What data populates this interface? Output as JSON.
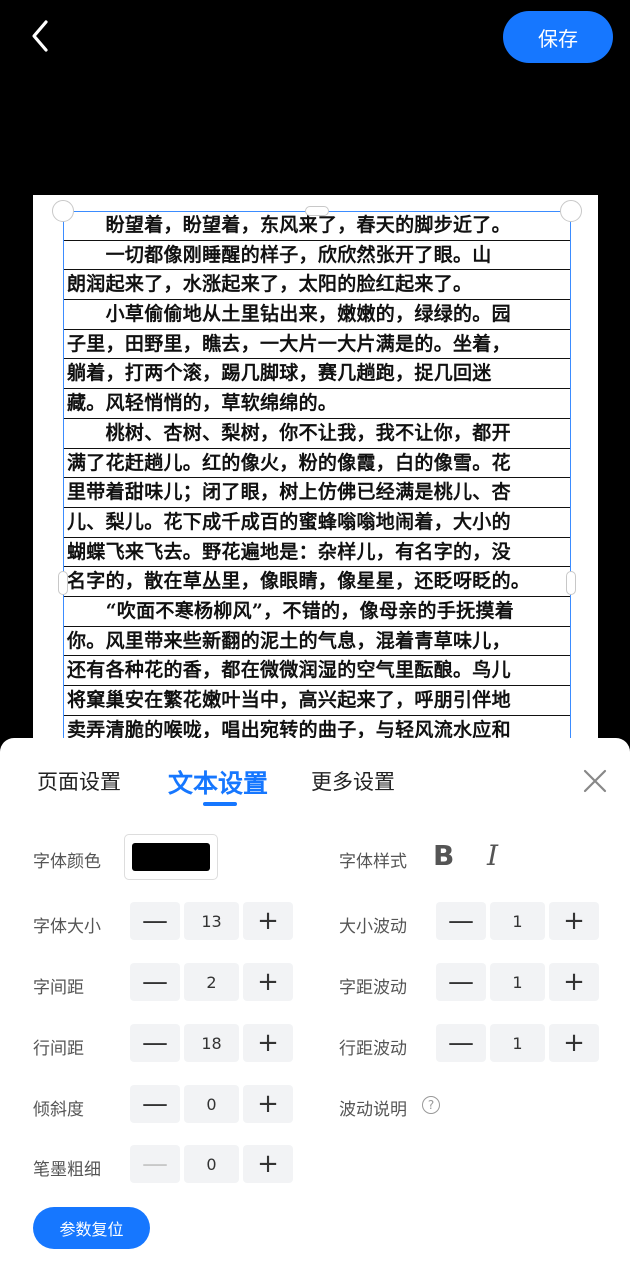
{
  "header": {
    "save_label": "保存",
    "back_icon": "chevron-left-icon"
  },
  "paper": {
    "lines": [
      "　　盼望着，盼望着，东风来了，春天的脚步近了。",
      "　　一切都像刚睡醒的样子，欣欣然张开了眼。山",
      "朗润起来了，水涨起来了，太阳的脸红起来了。",
      "　　小草偷偷地从土里钻出来，嫩嫩的，绿绿的。园",
      "子里，田野里，瞧去，一大片一大片满是的。坐着，",
      "躺着，打两个滚，踢几脚球，赛几趟跑，捉几回迷",
      "藏。风轻悄悄的，草软绵绵的。",
      "　　桃树、杏树、梨树，你不让我，我不让你，都开",
      "满了花赶趟儿。红的像火，粉的像霞，白的像雪。花",
      "里带着甜味儿；闭了眼，树上仿佛已经满是桃儿、杏",
      "儿、梨儿。花下成千成百的蜜蜂嗡嗡地闹着，大小的",
      "蝴蝶飞来飞去。野花遍地是：杂样儿，有名字的，没",
      "名字的，散在草丛里，像眼睛，像星星，还眨呀眨的。",
      "　　“吹面不寒杨柳风”，不错的，像母亲的手抚摸着",
      "你。风里带来些新翻的泥土的气息，混着青草味儿，",
      "还有各种花的香，都在微微润湿的空气里酝酿。鸟儿",
      "将窠巢安在繁花嫩叶当中，高兴起来了，呼朋引伴地",
      "卖弄清脆的喉咙，唱出宛转的曲子，与轻风流水应和"
    ]
  },
  "tabs": [
    {
      "label": "页面设置"
    },
    {
      "label": "文本设置"
    },
    {
      "label": "更多设置"
    }
  ],
  "settings": {
    "font_color_label": "字体颜色",
    "font_color": "#000000",
    "font_style_label": "字体样式",
    "bold_glyph": "B",
    "italic_glyph": "I",
    "font_size": {
      "label": "字体大小",
      "value": "13"
    },
    "size_wave": {
      "label": "大小波动",
      "value": "1"
    },
    "char_spacing": {
      "label": "字间距",
      "value": "2"
    },
    "spacing_wave": {
      "label": "字距波动",
      "value": "1"
    },
    "line_spacing": {
      "label": "行间距",
      "value": "18"
    },
    "line_wave": {
      "label": "行距波动",
      "value": "1"
    },
    "slant": {
      "label": "倾斜度",
      "value": "0"
    },
    "wave_help_label": "波动说明",
    "ink_weight": {
      "label": "笔墨粗细",
      "value": "0"
    },
    "minus_glyph": "—",
    "plus_glyph": "+",
    "help_glyph": "?"
  },
  "reset_label": "参数复位",
  "colors": {
    "accent": "#1677ff",
    "background": "#000000"
  }
}
